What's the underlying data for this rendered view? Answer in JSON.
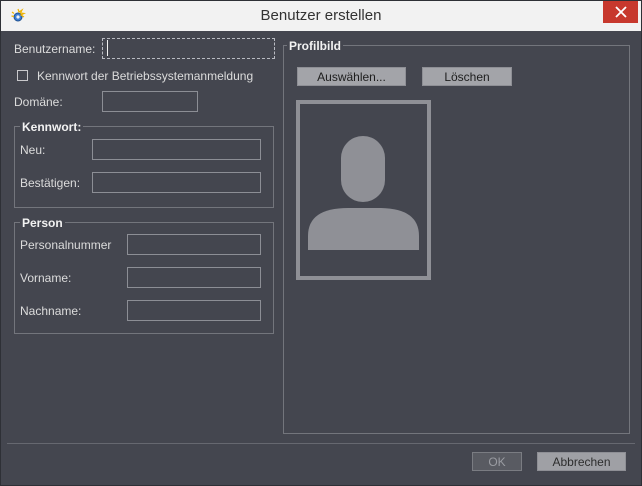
{
  "window": {
    "title": "Benutzer erstellen",
    "app_icon": "gear-sparkle-icon",
    "close_icon": "close-icon"
  },
  "account": {
    "username_label": "Benutzername:",
    "username_value": "",
    "os_login_label": "Kennwort der Betriebssystemanmeldung",
    "os_login_checked": false,
    "domain_label": "Domäne:",
    "domain_value": ""
  },
  "password": {
    "title": "Kennwort:",
    "new_label": "Neu:",
    "new_value": "",
    "confirm_label": "Bestätigen:",
    "confirm_value": ""
  },
  "person": {
    "title": "Person",
    "number_label": "Personalnummer",
    "number_value": "",
    "firstname_label": "Vorname:",
    "firstname_value": "",
    "lastname_label": "Nachname:",
    "lastname_value": ""
  },
  "profile": {
    "title": "Profilbild",
    "select_label": "Auswählen...",
    "delete_label": "Löschen",
    "placeholder_icon": "user-silhouette-icon"
  },
  "footer": {
    "ok_label": "OK",
    "cancel_label": "Abbrechen"
  },
  "colors": {
    "background": "#44464f",
    "titlebar": "#f2f2f2",
    "close": "#c7382d",
    "button": "#a3a4a9"
  }
}
